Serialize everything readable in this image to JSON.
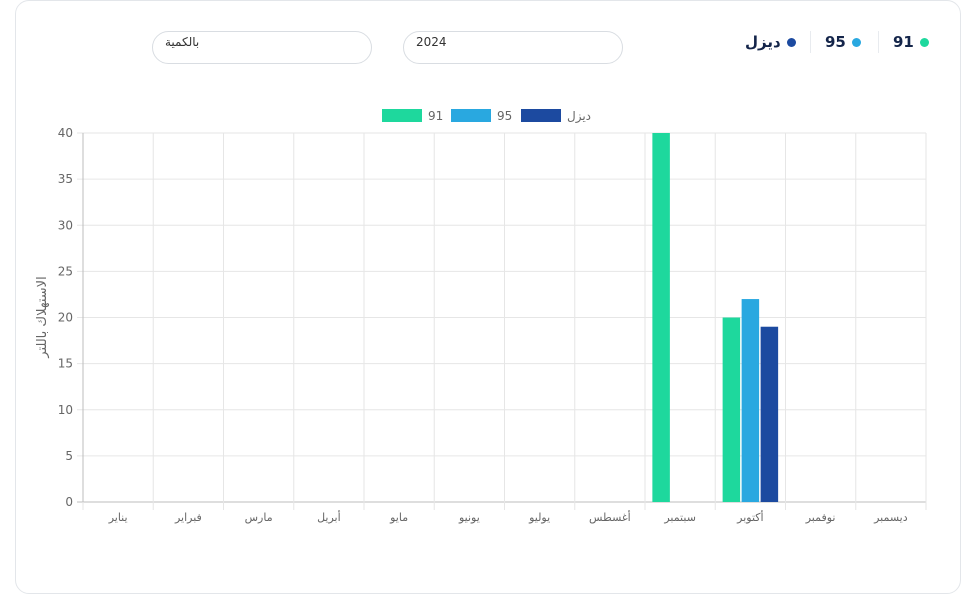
{
  "toggles": [
    {
      "label": "91",
      "color": "#1ed89d"
    },
    {
      "label": "95",
      "color": "#29a8e0"
    },
    {
      "label": "ديزل",
      "color": "#1c4aa0"
    }
  ],
  "filters": {
    "year": "2024",
    "mode": "بالكمية"
  },
  "chart_data": {
    "type": "bar",
    "categories": [
      "يناير",
      "فبراير",
      "مارس",
      "أبريل",
      "مايو",
      "يونيو",
      "يوليو",
      "أغسطس",
      "سبتمبر",
      "أكتوبر",
      "نوفمبر",
      "ديسمبر"
    ],
    "series": [
      {
        "name": "91",
        "color": "#1ed89d",
        "values": [
          0,
          0,
          0,
          0,
          0,
          0,
          0,
          0,
          40,
          20,
          0,
          0
        ]
      },
      {
        "name": "95",
        "color": "#29a8e0",
        "values": [
          0,
          0,
          0,
          0,
          0,
          0,
          0,
          0,
          0,
          22,
          0,
          0
        ]
      },
      {
        "name": "ديزل",
        "color": "#1c4aa0",
        "values": [
          0,
          0,
          0,
          0,
          0,
          0,
          0,
          0,
          0,
          19,
          0,
          0
        ]
      }
    ],
    "ylabel": "الاستهلاك باللتر",
    "ylim": [
      0,
      40
    ],
    "yticks": [
      0,
      5,
      10,
      15,
      20,
      25,
      30,
      35,
      40
    ],
    "grid": true,
    "legend": "top-center"
  }
}
